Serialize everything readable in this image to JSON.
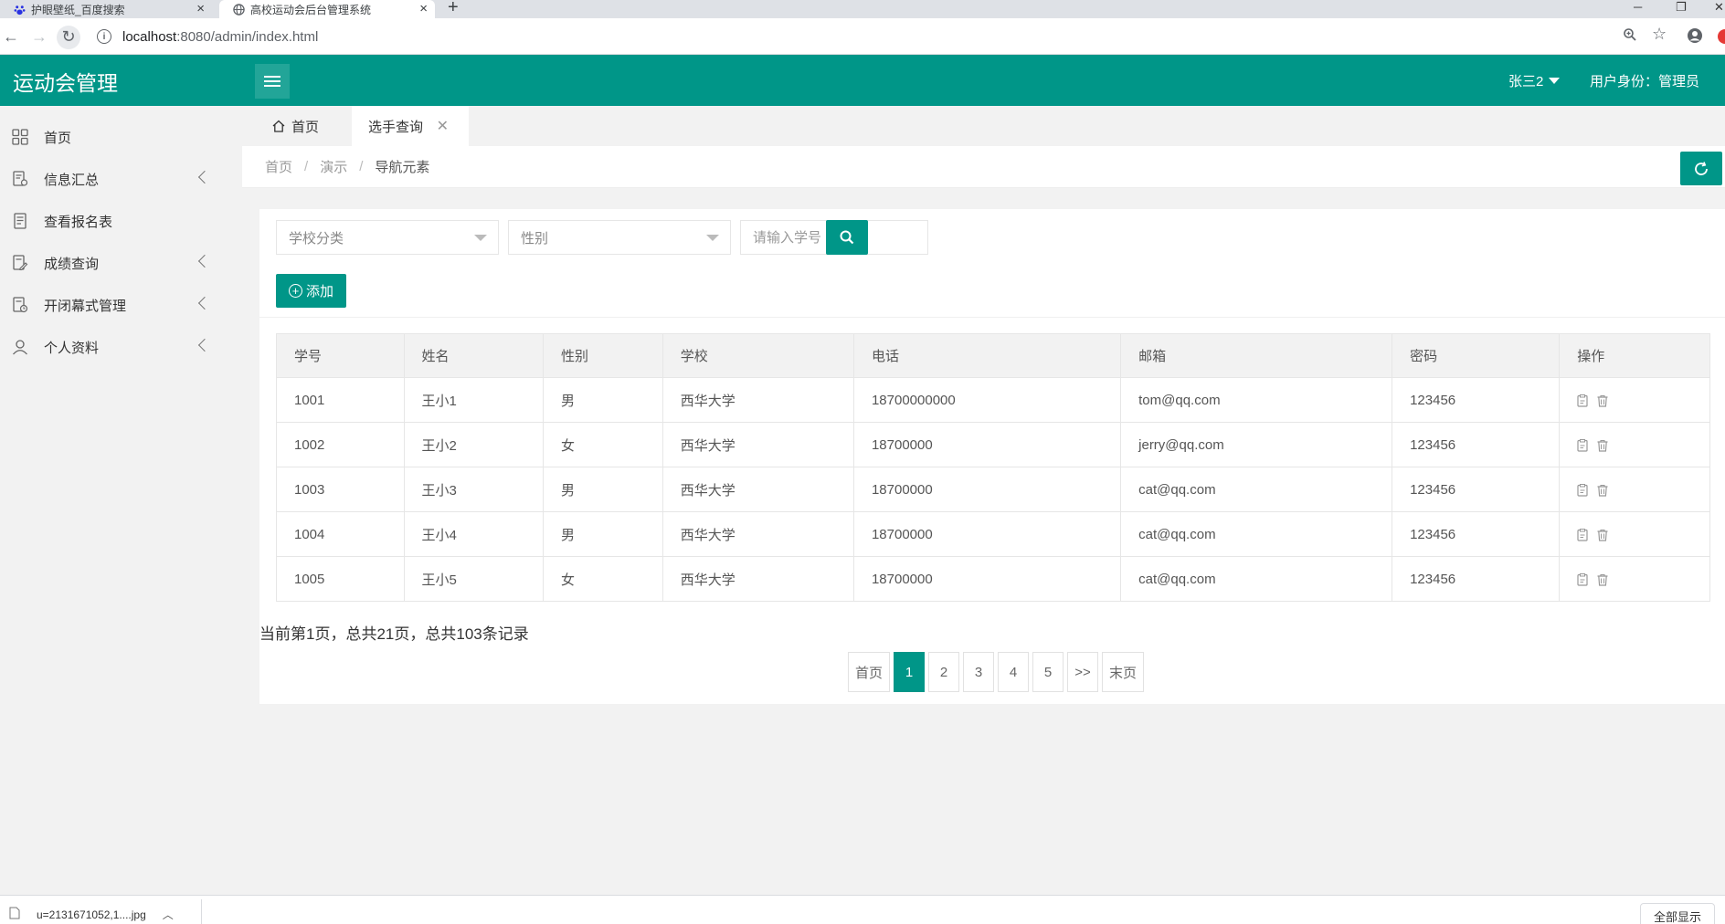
{
  "browser": {
    "tabs": [
      {
        "title": "护眼壁纸_百度搜索",
        "favicon": "baidu-paw-icon"
      },
      {
        "title": "高校运动会后台管理系统",
        "favicon": "globe-icon"
      }
    ],
    "url_host": "localhost",
    "url_rest": ":8080/admin/index.html"
  },
  "header": {
    "logo": "运动会管理",
    "user_name": "张三2",
    "role_text": "用户身份：管理员"
  },
  "sidebar": {
    "items": [
      {
        "label": "首页",
        "icon": "dashboard-grid-icon"
      },
      {
        "label": "信息汇总",
        "icon": "document-edit-icon"
      },
      {
        "label": "查看报名表",
        "icon": "document-list-icon"
      },
      {
        "label": "成绩查询",
        "icon": "document-edit-icon"
      },
      {
        "label": "开闭幕式管理",
        "icon": "document-clock-icon"
      },
      {
        "label": "个人资料",
        "icon": "user-icon"
      }
    ]
  },
  "page_tabs": {
    "home": "首页",
    "current": "选手查询"
  },
  "breadcrumb": [
    "首页",
    "演示",
    "导航元素"
  ],
  "filters": {
    "school_placeholder": "学校分类",
    "gender_placeholder": "性别",
    "student_id_placeholder": "请输入学号"
  },
  "add_button": "添加",
  "table": {
    "headers": [
      "学号",
      "姓名",
      "性别",
      "学校",
      "电话",
      "邮箱",
      "密码",
      "操作"
    ],
    "rows": [
      [
        "1001",
        "王小1",
        "男",
        "西华大学",
        "18700000000",
        "tom@qq.com",
        "123456"
      ],
      [
        "1002",
        "王小2",
        "女",
        "西华大学",
        "18700000",
        "jerry@qq.com",
        "123456"
      ],
      [
        "1003",
        "王小3",
        "男",
        "西华大学",
        "18700000",
        "cat@qq.com",
        "123456"
      ],
      [
        "1004",
        "王小4",
        "男",
        "西华大学",
        "18700000",
        "cat@qq.com",
        "123456"
      ],
      [
        "1005",
        "王小5",
        "女",
        "西华大学",
        "18700000",
        "cat@qq.com",
        "123456"
      ]
    ]
  },
  "pagination": {
    "summary": "当前第1页，总共21页，总共103条记录",
    "first": "首页",
    "pages": [
      "1",
      "2",
      "3",
      "4",
      "5"
    ],
    "current_page": "1",
    "next": ">>",
    "last": "末页"
  },
  "download_bar": {
    "filename": "u=2131671052,1....jpg",
    "show_all": "全部显示"
  },
  "colors": {
    "primary": "#009688",
    "sidebar_bg": "#f2f2f2"
  }
}
